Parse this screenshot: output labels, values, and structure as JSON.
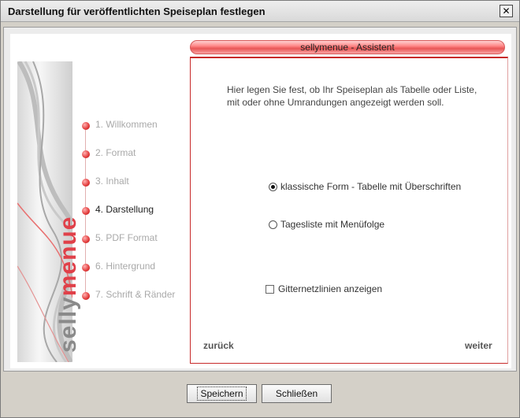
{
  "window": {
    "title": "Darstellung für veröffentlichten Speiseplan festlegen",
    "close_glyph": "✕"
  },
  "brand": {
    "part1": "selly",
    "part2": "menue"
  },
  "steps": [
    {
      "label": "1. Willkommen",
      "active": false
    },
    {
      "label": "2. Format",
      "active": false
    },
    {
      "label": "3. Inhalt",
      "active": false
    },
    {
      "label": "4. Darstellung",
      "active": true
    },
    {
      "label": "5. PDF Format",
      "active": false
    },
    {
      "label": "6. Hintergrund",
      "active": false
    },
    {
      "label": "7. Schrift & Ränder",
      "active": false
    }
  ],
  "assistant": {
    "header": "sellymenue - Assistent",
    "description": "Hier legen Sie fest, ob Ihr Speiseplan als Tabelle oder Liste, mit oder ohne Umrandungen angezeigt werden soll.",
    "options": [
      {
        "label": "klassische Form - Tabelle mit Überschriften",
        "selected": true
      },
      {
        "label": "Tagesliste mit Menüfolge",
        "selected": false
      }
    ],
    "gridlines": {
      "label": "Gitternetzlinien anzeigen",
      "checked": false
    },
    "back_label": "zurück",
    "next_label": "weiter"
  },
  "buttons": {
    "save": "Speichern",
    "close": "Schließen"
  },
  "colors": {
    "accent": "#e04049",
    "panel_border": "#c82a2a"
  }
}
